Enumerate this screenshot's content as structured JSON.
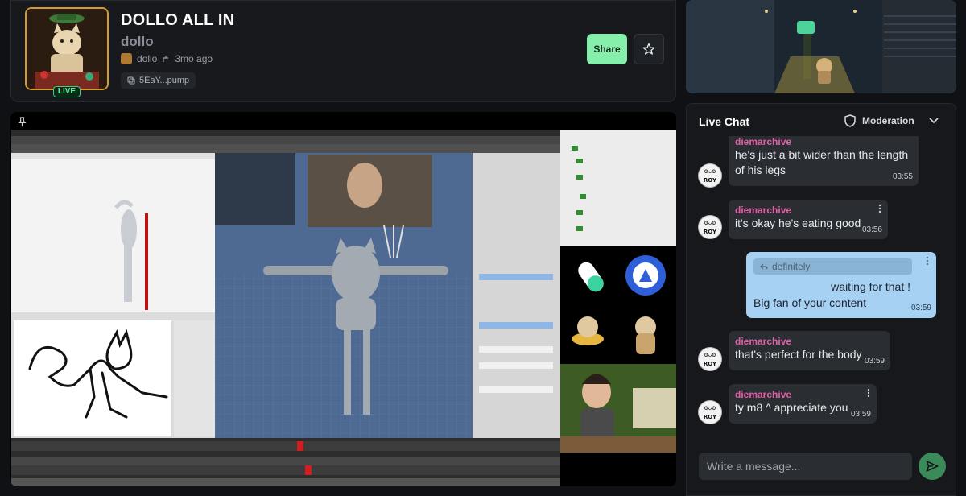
{
  "coin": {
    "title": "DOLLO ALL IN",
    "ticker": "dollo",
    "creator": "dollo",
    "age": "3mo ago",
    "address": "5EaY...pump",
    "live_label": "LIVE",
    "share_label": "Share"
  },
  "chat": {
    "title": "Live Chat",
    "moderation_label": "Moderation",
    "input_placeholder": "Write a message...",
    "messages": [
      {
        "user": "diemarchive",
        "lines": [
          "he's just a bit wider than the length",
          "of his legs"
        ],
        "time": "03:55"
      },
      {
        "user": "diemarchive",
        "lines": [
          "it's okay he's eating good"
        ],
        "time": "03:56"
      },
      {
        "user": "diemarchive",
        "lines": [
          "that's perfect for the body"
        ],
        "time": "03:59"
      },
      {
        "user": "diemarchive",
        "lines": [
          "ty m8 ^ appreciate you"
        ],
        "time": "03:59"
      }
    ],
    "own_message": {
      "reply_to": "definitely",
      "line1": "waiting for that !",
      "line2": "Big fan of your content",
      "time": "03:59"
    },
    "avatar_text": "ROY"
  },
  "colors": {
    "accent_green": "#86efac",
    "live_green": "#5cf09c",
    "username_pink": "#e15fa6",
    "own_bubble": "#a6d1f3",
    "avatar_border": "#d79a2c"
  },
  "icons": [
    "copy-icon",
    "star-icon",
    "pin-icon",
    "shield-icon",
    "chevron-down-icon",
    "send-icon",
    "more-vertical-icon",
    "reply-icon",
    "sprout-icon"
  ]
}
